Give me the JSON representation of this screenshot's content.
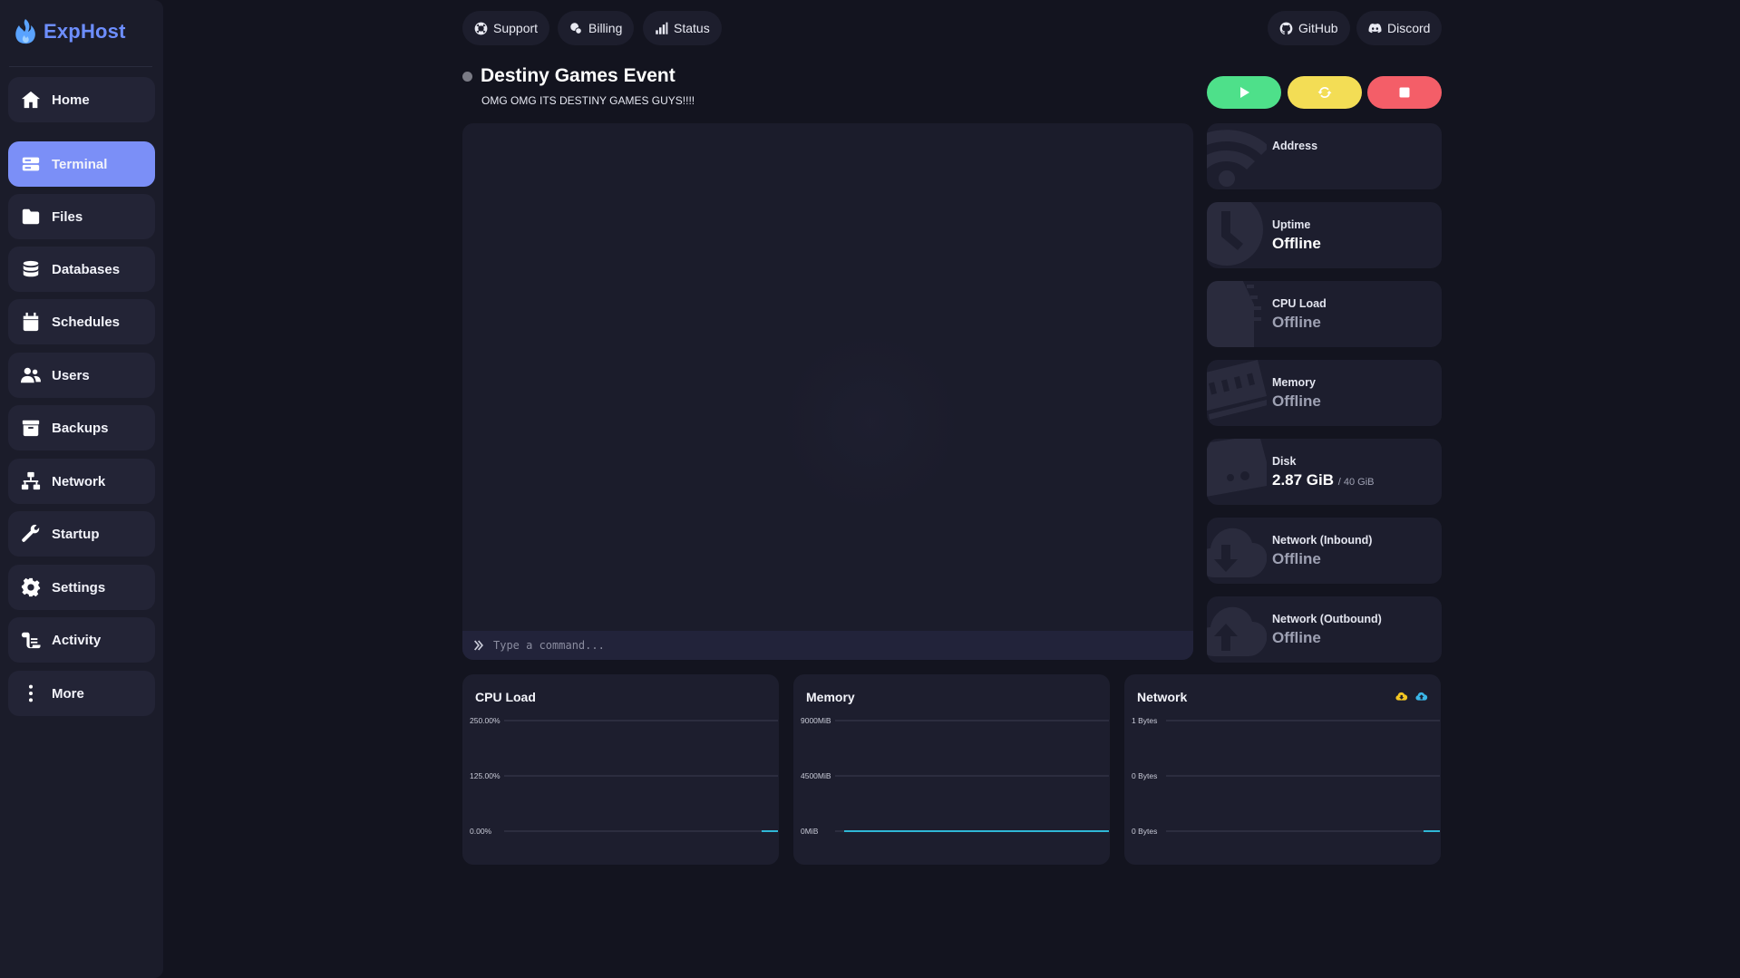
{
  "app": {
    "name": "ExpHost",
    "brand_color": "#6d8eff"
  },
  "sidebar": {
    "items": [
      {
        "label": "Home",
        "icon": "home-icon",
        "active": false
      },
      {
        "label": "Terminal",
        "icon": "terminal-icon",
        "active": true
      },
      {
        "label": "Files",
        "icon": "folder-icon",
        "active": false
      },
      {
        "label": "Databases",
        "icon": "database-icon",
        "active": false
      },
      {
        "label": "Schedules",
        "icon": "calendar-icon",
        "active": false
      },
      {
        "label": "Users",
        "icon": "users-icon",
        "active": false
      },
      {
        "label": "Backups",
        "icon": "archive-icon",
        "active": false
      },
      {
        "label": "Network",
        "icon": "network-icon",
        "active": false
      },
      {
        "label": "Startup",
        "icon": "wrench-icon",
        "active": false
      },
      {
        "label": "Settings",
        "icon": "gear-icon",
        "active": false
      },
      {
        "label": "Activity",
        "icon": "scroll-icon",
        "active": false
      },
      {
        "label": "More",
        "icon": "more-vertical-icon",
        "active": false
      }
    ]
  },
  "topbar": {
    "left": [
      {
        "label": "Support",
        "icon": "lifebuoy-icon"
      },
      {
        "label": "Billing",
        "icon": "coins-icon"
      },
      {
        "label": "Status",
        "icon": "signal-icon"
      }
    ],
    "right": [
      {
        "label": "GitHub",
        "icon": "github-icon"
      },
      {
        "label": "Discord",
        "icon": "discord-icon"
      }
    ]
  },
  "server": {
    "name": "Destiny Games Event",
    "description": "OMG OMG ITS DESTINY GAMES GUYS!!!!",
    "status_color": "#7a7b85"
  },
  "power": {
    "start_color": "#4ee08a",
    "restart_color": "#f3dd55",
    "stop_color": "#f45e68"
  },
  "console": {
    "placeholder": "Type a command..."
  },
  "stats": {
    "address": {
      "label": "Address",
      "value": ""
    },
    "uptime": {
      "label": "Uptime",
      "value": "Offline"
    },
    "cpu": {
      "label": "CPU Load",
      "value": "Offline"
    },
    "memory": {
      "label": "Memory",
      "value": "Offline"
    },
    "disk": {
      "label": "Disk",
      "value": "2.87 GiB",
      "limit": "/ 40 GiB"
    },
    "net_in": {
      "label": "Network (Inbound)",
      "value": "Offline"
    },
    "net_out": {
      "label": "Network (Outbound)",
      "value": "Offline"
    }
  },
  "chart_data": [
    {
      "type": "area",
      "title": "CPU Load",
      "yticks": [
        "250.00%",
        "125.00%",
        "0.00%"
      ],
      "ylim": [
        0,
        250
      ],
      "series": [
        {
          "values": [
            0,
            0,
            0
          ]
        }
      ],
      "color": "#2fb8d6"
    },
    {
      "type": "area",
      "title": "Memory",
      "yticks": [
        "9000MiB",
        "4500MiB",
        "0MiB"
      ],
      "ylim": [
        0,
        9000
      ],
      "series": [
        {
          "values": [
            0,
            0,
            0,
            0,
            0,
            0,
            0,
            0,
            0,
            0,
            0,
            0,
            0,
            0,
            0,
            0,
            0,
            0,
            0,
            0
          ]
        }
      ],
      "color": "#2fb8d6"
    },
    {
      "type": "area",
      "title": "Network",
      "yticks": [
        "1 Bytes",
        "0 Bytes",
        "0 Bytes"
      ],
      "ylim": [
        0,
        1
      ],
      "series": [
        {
          "values": [
            0,
            0
          ]
        },
        {
          "values": [
            0,
            0
          ]
        }
      ],
      "legend_icons": [
        "cloud-download-icon",
        "cloud-upload-icon"
      ],
      "legend_colors": [
        "#f3c623",
        "#3bb6e8"
      ],
      "color": "#2fb8d6"
    }
  ]
}
